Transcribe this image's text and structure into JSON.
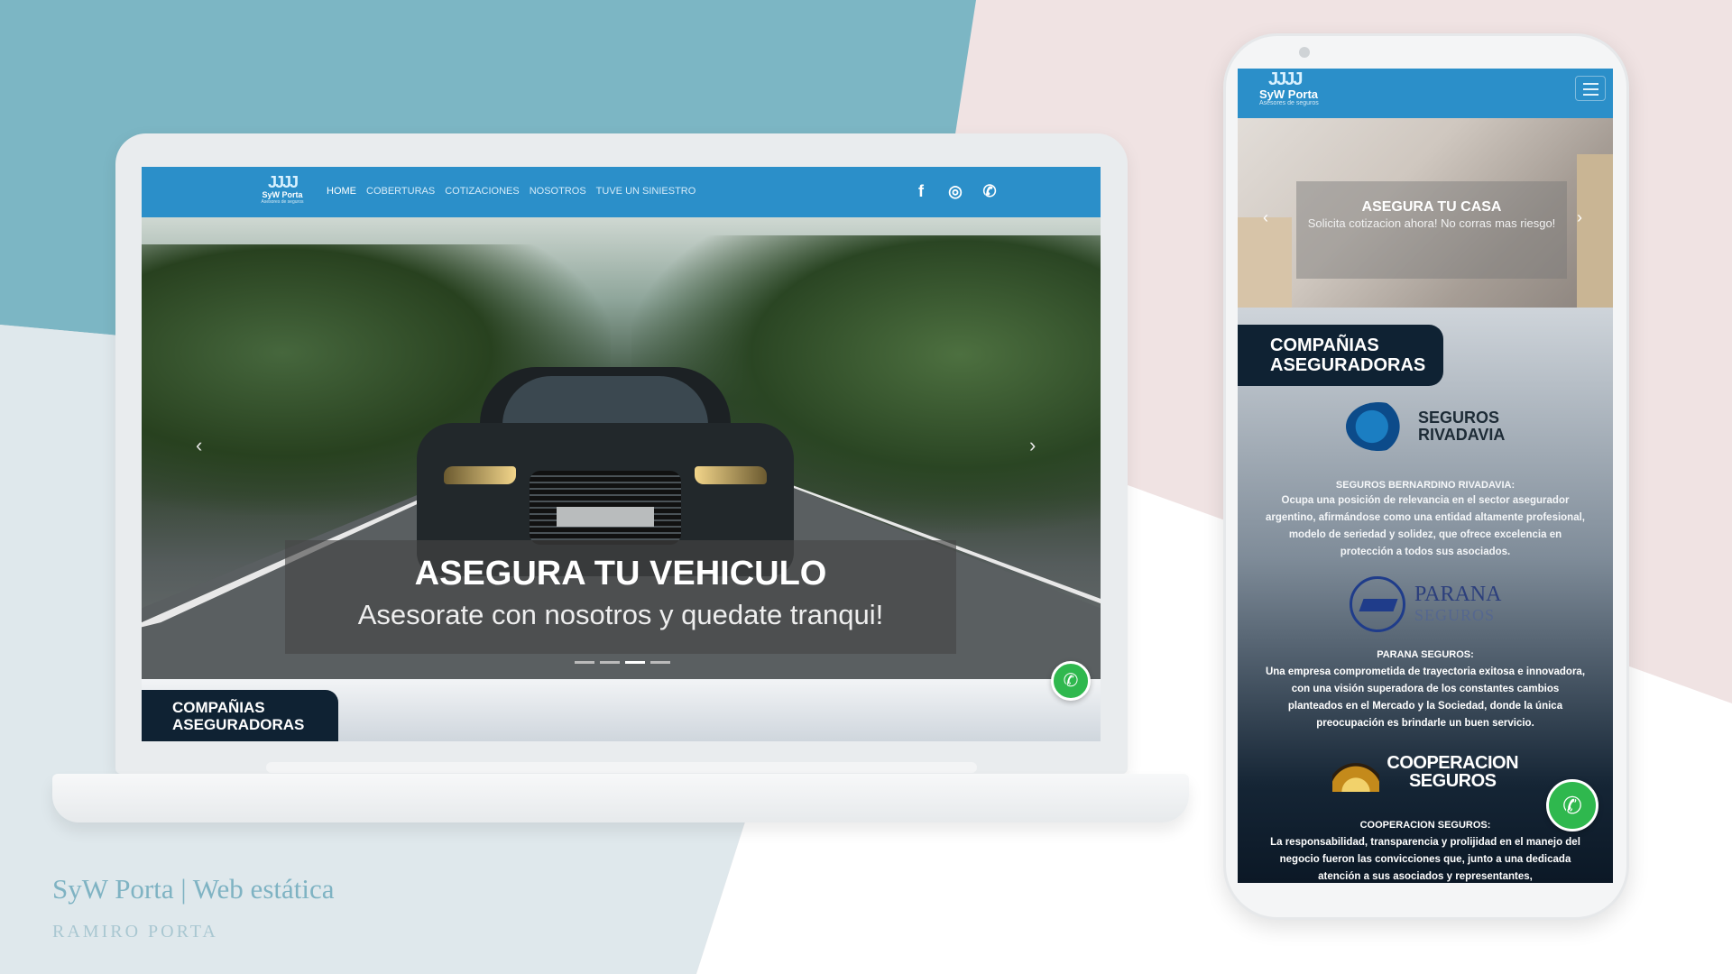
{
  "colors": {
    "nav_blue": "#2b8fc9",
    "dark_navy": "#0f2233",
    "whatsapp_green": "#2fb84e",
    "bg_teal": "#7cb6c4",
    "bg_pink": "#f0e3e3"
  },
  "desktop": {
    "logo": {
      "mark": "JJJJ",
      "name": "SyW Porta",
      "tagline": "Asesores de seguros"
    },
    "nav": [
      "HOME",
      "COBERTURAS",
      "COTIZACIONES",
      "NOSOTROS",
      "TUVE UN SINIESTRO"
    ],
    "social_icons": [
      "facebook-icon",
      "instagram-icon",
      "whatsapp-icon"
    ],
    "social_glyphs": {
      "facebook": "f",
      "instagram": "◎",
      "whatsapp": "✆"
    },
    "hero": {
      "title": "ASEGURA TU VEHICULO",
      "subtitle": "Asesorate con nosotros y quedate tranqui!",
      "slide_count": 4,
      "active_slide": 3,
      "prev": "‹",
      "next": "›"
    },
    "section_title": "COMPAÑIAS ASEGURADORAS",
    "whatsapp_glyph": "✆"
  },
  "mobile": {
    "logo": {
      "mark": "JJJJ",
      "name": "SyW Porta",
      "tagline": "Asesores de seguros"
    },
    "hero": {
      "title": "ASEGURA TU CASA",
      "subtitle": "Solicita cotizacion ahora! No corras mas riesgo!",
      "prev": "‹",
      "next": "›"
    },
    "section_title": "COMPAÑIAS ASEGURADORAS",
    "companies": [
      {
        "logo_line1": "SEGUROS",
        "logo_line2": "RIVADAVIA",
        "title": "SEGUROS BERNARDINO RIVADAVIA:",
        "description": "Ocupa una posición de relevancia en el sector asegurador argentino, afirmándose como una entidad altamente profesional, modelo de seriedad y solidez, que ofrece excelencia en protección a todos sus asociados."
      },
      {
        "logo_line1": "PARANA",
        "logo_line2": "SEGUROS",
        "title": "PARANA SEGUROS:",
        "description": "Una empresa comprometida de trayectoria exitosa e innovadora, con una visión superadora de los constantes cambios planteados en el Mercado y la Sociedad, donde la única preocupación es brindarle un buen servicio."
      },
      {
        "logo_line1": "COOPERACION",
        "logo_line2": "SEGUROS",
        "title": "COOPERACION SEGUROS:",
        "description": "La responsabilidad, transparencia y prolijidad en el manejo del negocio fueron las convicciones que, junto a una dedicada atención a sus asociados y representantes,"
      }
    ],
    "whatsapp_glyph": "✆"
  },
  "footer": {
    "title": "SyW Porta | Web estática",
    "subtitle": "RAMIRO PORTA"
  }
}
